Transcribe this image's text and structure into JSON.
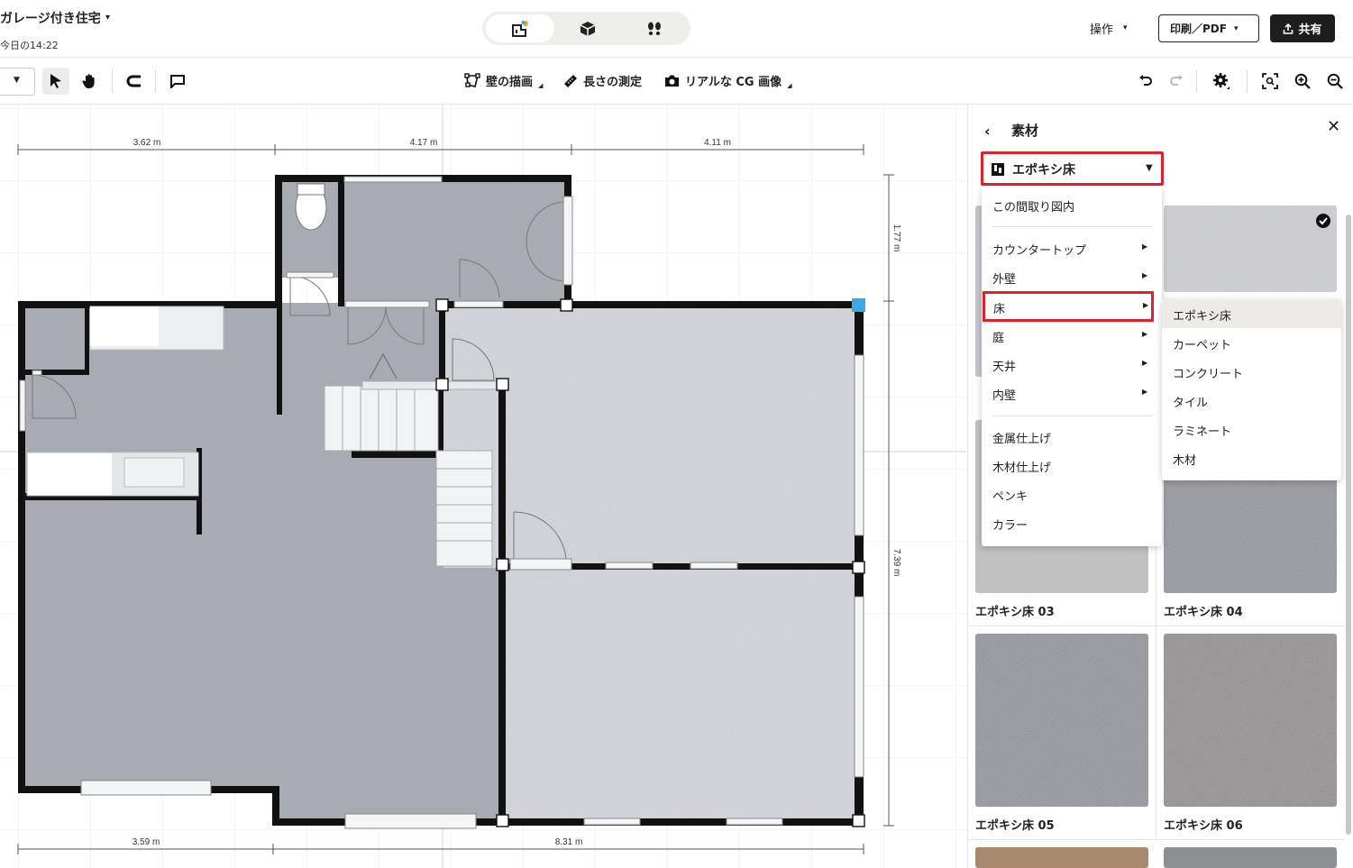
{
  "header": {
    "project_title": "ガレージ付き住宅",
    "timestamp": "今日の14:22",
    "view_modes": [
      "2d-plan",
      "3d-view",
      "walkthrough"
    ],
    "actions_label": "操作",
    "print_label": "印刷／PDF",
    "share_label": "共有"
  },
  "toolbar": {
    "draw_walls_label": "壁の描画",
    "measure_label": "長さの測定",
    "render_label": "リアルな CG 画像"
  },
  "plan": {
    "top_dims": [
      "3.62 m",
      "4.17 m",
      "4.11 m"
    ],
    "bottom_dims": [
      "3.59 m",
      "8.31 m"
    ],
    "right_dims": [
      "1.77 m",
      "7.39 m"
    ],
    "colors": {
      "room": "#a8abb1",
      "wall": "#111111",
      "epoxy": "#dcdde3",
      "selected_handle": "#3aa9e6",
      "grid": "#ebebeb"
    }
  },
  "panel": {
    "title": "素材",
    "category_select": "エポキシ床",
    "menu": {
      "in_plan": "この間取り図内",
      "categories": [
        "カウンタートップ",
        "外壁",
        "床",
        "庭",
        "天井",
        "内壁"
      ],
      "finishes": [
        "金属仕上げ",
        "木材仕上げ",
        "ペンキ",
        "カラー"
      ]
    },
    "submenu": [
      "エポキシ床",
      "カーペット",
      "コンクリート",
      "タイル",
      "ラミネート",
      "木材"
    ],
    "materials": [
      {
        "name": "エポキシ床 03"
      },
      {
        "name": "エポキシ床 04"
      },
      {
        "name": "エポキシ床 05"
      },
      {
        "name": "エポキシ床 06"
      }
    ],
    "highlight_color": "#e0202a"
  }
}
